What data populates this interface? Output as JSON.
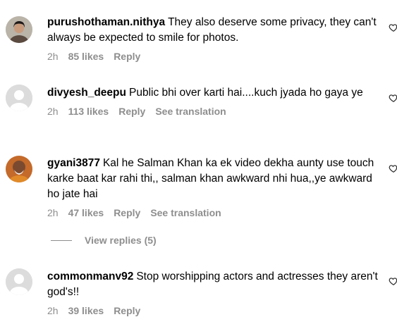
{
  "comments": [
    {
      "username": "purushothaman.nithya",
      "text": "They also deserve some privacy, they can't always be expected to smile for photos.",
      "time": "2h",
      "likes": "85 likes",
      "reply": "Reply",
      "see_translation": ""
    },
    {
      "username": "divyesh_deepu",
      "text": "Public bhi over karti hai....kuch jyada ho gaya ye",
      "time": "2h",
      "likes": "113 likes",
      "reply": "Reply",
      "see_translation": "See translation"
    },
    {
      "username": "gyani3877",
      "text": "Kal he Salman Khan ka ek video dekha aunty use touch karke baat kar rahi thi,, salman khan awkward nhi hua,,ye awkward ho jate hai",
      "time": "2h",
      "likes": "47 likes",
      "reply": "Reply",
      "see_translation": "See translation"
    },
    {
      "username": "commonmanv92",
      "text": "Stop worshipping actors and actresses they aren't god's!!",
      "time": "2h",
      "likes": "39 likes",
      "reply": "Reply",
      "see_translation": ""
    }
  ],
  "view_replies": "View replies (5)",
  "icons": {
    "like": "heart-icon"
  },
  "colors": {
    "meta": "#8e8e8e",
    "placeholder_avatar": "#dcdcdc"
  }
}
